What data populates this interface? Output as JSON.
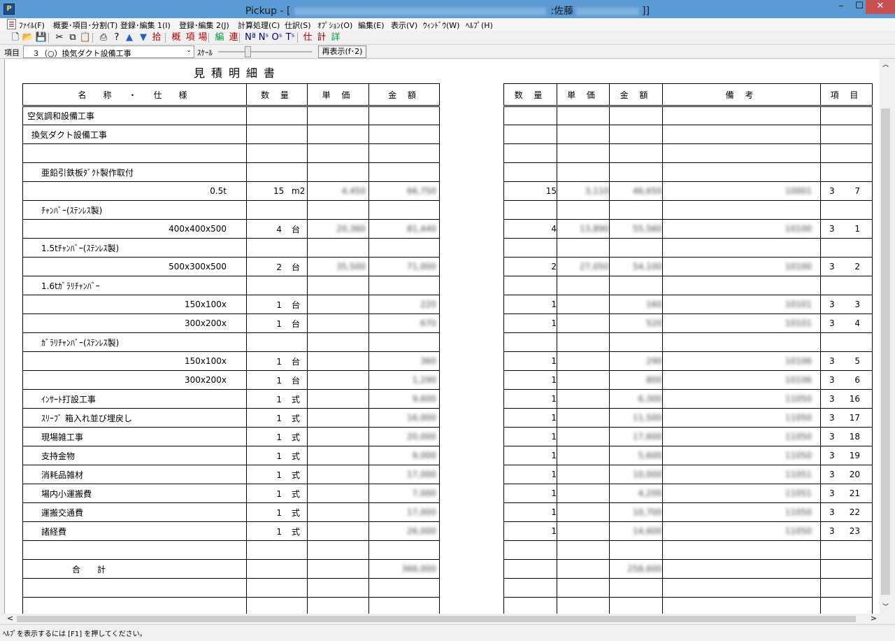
{
  "window": {
    "app_name": "Pickup - [",
    "user_part": ":佐藤",
    "close_bracket": "]]",
    "app_icon": "pickup-app-icon",
    "min_glyph": "–",
    "max_glyph": "☐",
    "close_glyph": "✕"
  },
  "menu": {
    "items": [
      "ﾌｧｲﾙ(F)",
      "概要･項目･分割(T)",
      "登録･編集 1(I)",
      "登録･編集 2(J)",
      "計算処理(C)",
      "仕訳(S)",
      "ｵﾌﾟｼｮﾝ(O)",
      "編集(E)",
      "表示(V)",
      "ｳｨﾝﾄﾞｳ(W)",
      "ﾍﾙﾌﾟ(H)"
    ],
    "mdi_min": "_",
    "mdi_restore": "▭",
    "mdi_close": "✕"
  },
  "toolbar": {
    "buttons": [
      {
        "name": "new-doc-icon",
        "glyph": "🗋"
      },
      {
        "name": "open-folder-icon",
        "glyph": "📂"
      },
      {
        "name": "save-icon",
        "glyph": "💾"
      },
      {
        "name": "cut-icon",
        "glyph": "✂"
      },
      {
        "name": "copy-icon",
        "glyph": "⧉"
      },
      {
        "name": "paste-icon",
        "glyph": "📋"
      },
      {
        "name": "print-icon",
        "glyph": "⎙"
      },
      {
        "name": "help-icon",
        "glyph": "?"
      },
      {
        "name": "move-up-icon",
        "glyph": "▲"
      },
      {
        "name": "move-down-icon",
        "glyph": "▼"
      },
      {
        "name": "extract-icon",
        "glyph": "拾"
      },
      {
        "name": "summary-icon",
        "glyph": "概"
      },
      {
        "name": "item-icon",
        "glyph": "項"
      },
      {
        "name": "lot-icon",
        "glyph": "場"
      },
      {
        "name": "edit-icon",
        "glyph": "編"
      },
      {
        "name": "link-icon",
        "glyph": "連"
      },
      {
        "name": "n-number-icon",
        "glyph": "Nª"
      },
      {
        "name": "n-sort-icon",
        "glyph": "Nˢ"
      },
      {
        "name": "o-sort-icon",
        "glyph": "Oˢ"
      },
      {
        "name": "t-sort-icon",
        "glyph": "Tˢ"
      },
      {
        "name": "journal-icon",
        "glyph": "仕"
      },
      {
        "name": "calc-icon",
        "glyph": "計"
      },
      {
        "name": "detail-icon",
        "glyph": "詳"
      }
    ]
  },
  "itembar": {
    "label": "項目",
    "selected": "３（○）換気ダクト設備工事",
    "dropdown_arrow": "⌄",
    "scale_label": "ｽｹｰﾙ",
    "scale_value": 0.3,
    "redisplay_label": "再表示(f･2)"
  },
  "document": {
    "title": "見積明細書",
    "left_headers": [
      "名　称　・　仕　様",
      "数 量",
      "単 価",
      "金 額"
    ],
    "right_headers": [
      "数 量",
      "単 価",
      "金 額",
      "備 考",
      "項 目"
    ],
    "rows": [
      {
        "name": "空気調和設備工事",
        "indent": 0,
        "align": "l"
      },
      {
        "name": "換気ダクト設備工事",
        "indent": 1,
        "align": "l"
      },
      {
        "name": "",
        "align": "l"
      },
      {
        "name": "亜鉛引鉄板ﾀﾞｸﾄ製作取付",
        "indent": 3,
        "align": "l"
      },
      {
        "name": "0.5t",
        "align": "r",
        "qty": "15",
        "unit": "m2",
        "price": "4,450",
        "amount": "66,750",
        "r_qty": "15",
        "r_price": "3,110",
        "r_amount": "46,650",
        "note": "10001",
        "proj": "3",
        "item": "7"
      },
      {
        "name": "ﾁｬﾝﾊﾞｰ(ｽﾃﾝﾚｽ製)",
        "indent": 3,
        "align": "l"
      },
      {
        "name": "400x400x500",
        "align": "r",
        "qty": "4",
        "unit": "台",
        "price": "20,360",
        "amount": "81,440",
        "r_qty": "4",
        "r_price": "13,890",
        "r_amount": "55,560",
        "note": "10100",
        "proj": "3",
        "item": "1"
      },
      {
        "name": "1.5tﾁｬﾝﾊﾞｰ(ｽﾃﾝﾚｽ製)",
        "indent": 3,
        "align": "l"
      },
      {
        "name": "500x300x500",
        "align": "r",
        "qty": "2",
        "unit": "台",
        "price": "35,500",
        "amount": "71,000",
        "r_qty": "2",
        "r_price": "27,050",
        "r_amount": "54,100",
        "note": "10100",
        "proj": "3",
        "item": "2"
      },
      {
        "name": "1.6tｶﾞﾗﾘﾁｬﾝﾊﾞｰ",
        "indent": 3,
        "align": "l"
      },
      {
        "name": "150x100x",
        "align": "r",
        "qty": "1",
        "unit": "台",
        "price": "",
        "amount": "220",
        "r_qty": "1",
        "r_price": "",
        "r_amount": "160",
        "note": "10101",
        "proj": "3",
        "item": "3"
      },
      {
        "name": "300x200x",
        "align": "r",
        "qty": "1",
        "unit": "台",
        "price": "",
        "amount": "670",
        "r_qty": "1",
        "r_price": "",
        "r_amount": "520",
        "note": "10101",
        "proj": "3",
        "item": "4"
      },
      {
        "name": "ｶﾞﾗﾘﾁｬﾝﾊﾞｰ(ｽﾃﾝﾚｽ製)",
        "indent": 3,
        "align": "l"
      },
      {
        "name": "150x100x",
        "align": "r",
        "qty": "1",
        "unit": "台",
        "price": "",
        "amount": "360",
        "r_qty": "1",
        "r_price": "",
        "r_amount": "290",
        "note": "10106",
        "proj": "3",
        "item": "5"
      },
      {
        "name": "300x200x",
        "align": "r",
        "qty": "1",
        "unit": "台",
        "price": "",
        "amount": "1,290",
        "r_qty": "1",
        "r_price": "",
        "r_amount": "800",
        "note": "10106",
        "proj": "3",
        "item": "6"
      },
      {
        "name": "ｲﾝｻｰﾄ打設工事",
        "indent": 3,
        "align": "l",
        "qty": "1",
        "unit": "式",
        "price": "",
        "amount": "9,600",
        "r_qty": "1",
        "r_price": "",
        "r_amount": "6,300",
        "note": "11050",
        "proj": "3",
        "item": "16"
      },
      {
        "name": "ｽﾘｰﾌﾞ 箱入れ並び埋戻し",
        "indent": 3,
        "align": "l",
        "qty": "1",
        "unit": "式",
        "price": "",
        "amount": "16,000",
        "r_qty": "1",
        "r_price": "",
        "r_amount": "11,500",
        "note": "11050",
        "proj": "3",
        "item": "17"
      },
      {
        "name": "現場雑工事",
        "indent": 3,
        "align": "l",
        "qty": "1",
        "unit": "式",
        "price": "",
        "amount": "20,000",
        "r_qty": "1",
        "r_price": "",
        "r_amount": "17,600",
        "note": "11050",
        "proj": "3",
        "item": "18"
      },
      {
        "name": "支持金物",
        "indent": 3,
        "align": "l",
        "qty": "1",
        "unit": "式",
        "price": "",
        "amount": "9,000",
        "r_qty": "1",
        "r_price": "",
        "r_amount": "5,600",
        "note": "11050",
        "proj": "3",
        "item": "19"
      },
      {
        "name": "消耗品雑材",
        "indent": 3,
        "align": "l",
        "qty": "1",
        "unit": "式",
        "price": "",
        "amount": "17,000",
        "r_qty": "1",
        "r_price": "",
        "r_amount": "10,000",
        "note": "11051",
        "proj": "3",
        "item": "20"
      },
      {
        "name": "場内小運搬費",
        "indent": 3,
        "align": "l",
        "qty": "1",
        "unit": "式",
        "price": "",
        "amount": "7,000",
        "r_qty": "1",
        "r_price": "",
        "r_amount": "4,200",
        "note": "11051",
        "proj": "3",
        "item": "21"
      },
      {
        "name": "運搬交通費",
        "indent": 3,
        "align": "l",
        "qty": "1",
        "unit": "式",
        "price": "",
        "amount": "17,000",
        "r_qty": "1",
        "r_price": "",
        "r_amount": "10,700",
        "note": "11050",
        "proj": "3",
        "item": "22"
      },
      {
        "name": "諸経費",
        "indent": 3,
        "align": "l",
        "qty": "1",
        "unit": "式",
        "price": "",
        "amount": "26,000",
        "r_qty": "1",
        "r_price": "",
        "r_amount": "14,600",
        "note": "11050",
        "proj": "3",
        "item": "23"
      },
      {
        "name": "",
        "align": "l"
      },
      {
        "name": "合　　計",
        "align": "total",
        "amount": "366,000",
        "r_amount": "258,600"
      },
      {
        "name": "",
        "align": "l"
      },
      {
        "name": "",
        "align": "l"
      }
    ]
  },
  "scroll": {
    "up": "︿",
    "down": "﹀",
    "left": "<",
    "right": ">"
  },
  "status": {
    "text": "ﾍﾙﾌﾟを表示するには [F1] を押してください。"
  }
}
